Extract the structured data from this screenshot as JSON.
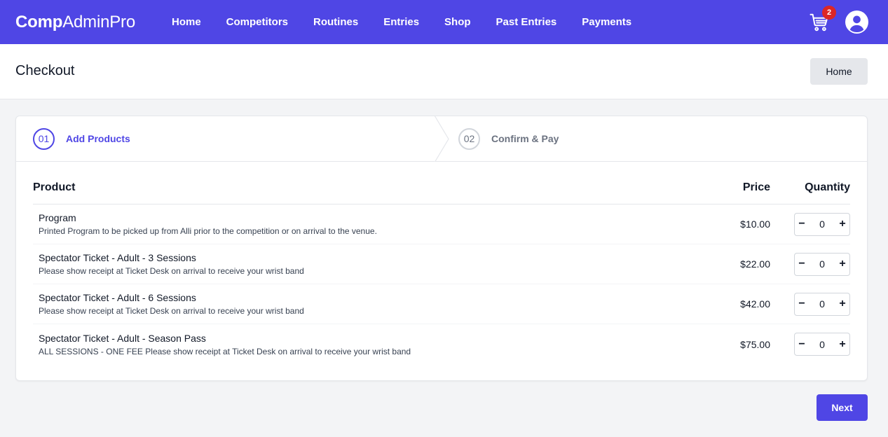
{
  "nav": {
    "brand_bold": "Comp",
    "brand_light": "AdminPro",
    "links": [
      "Home",
      "Competitors",
      "Routines",
      "Entries",
      "Shop",
      "Past Entries",
      "Payments"
    ],
    "cart_count": "2",
    "icons": {
      "cart": "cart-icon",
      "user": "user-avatar-icon"
    },
    "accent_color": "#4f46e5",
    "badge_color": "#dc2626"
  },
  "page": {
    "title": "Checkout",
    "home_button": "Home"
  },
  "steps": [
    {
      "number": "01",
      "label": "Add Products",
      "state": "active"
    },
    {
      "number": "02",
      "label": "Confirm & Pay",
      "state": "inactive"
    }
  ],
  "table": {
    "headers": {
      "product": "Product",
      "price": "Price",
      "quantity": "Quantity"
    },
    "rows": [
      {
        "name": "Program",
        "description": "Printed Program to be picked up from Alli prior to the competition or on arrival to the venue.",
        "price": "$10.00",
        "qty": "0"
      },
      {
        "name": "Spectator Ticket - Adult - 3 Sessions",
        "description": "Please show receipt at Ticket Desk on arrival to receive your wrist band",
        "price": "$22.00",
        "qty": "0"
      },
      {
        "name": "Spectator Ticket - Adult - 6 Sessions",
        "description": "Please show receipt at Ticket Desk on arrival to receive your wrist band",
        "price": "$42.00",
        "qty": "0"
      },
      {
        "name": "Spectator Ticket - Adult - Season Pass",
        "description": "ALL SESSIONS - ONE FEE Please show receipt at Ticket Desk on arrival to receive your wrist band",
        "price": "$75.00",
        "qty": "0"
      }
    ],
    "minus": "−",
    "plus": "+"
  },
  "footer": {
    "next_button": "Next"
  }
}
